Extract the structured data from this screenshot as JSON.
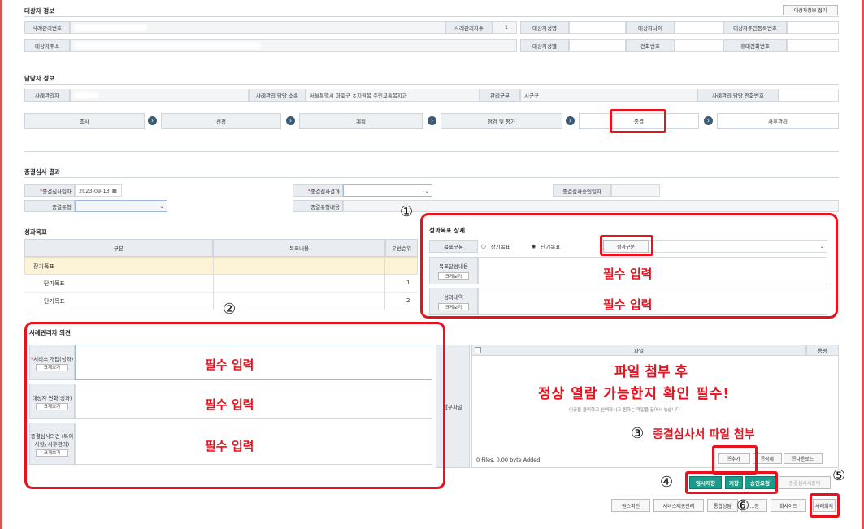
{
  "subject_info": {
    "title": "대상자 정보",
    "collapse_btn": "대상자정보 접기",
    "case_no_label": "사례관리번호",
    "case_count_label": "사례관리차수",
    "case_count_value": "1",
    "name_label": "대상자성명",
    "age_label": "대상자나이",
    "resident_no_label": "대상자주민등록번호",
    "address_label": "대상자주소",
    "gender_label": "대상자성별",
    "phone_label": "전화번호",
    "mobile_label": "휴대전화번호"
  },
  "manager_info": {
    "title": "담당자 정보",
    "manager_label": "사례관리자",
    "dept_label": "사례관리 담당 소속",
    "dept_value": "서울특별시 마포구 ㅎ지원복 주민교통복지과",
    "type_label": "관리구분",
    "type_value": "시군구",
    "phone_label": "사례관리 담당 전화번호"
  },
  "steps": [
    "조사",
    "선정",
    "계획",
    "점검 및 평가",
    "종결",
    "사후관리"
  ],
  "closing_review": {
    "title": "종결심사 결과",
    "date_label": "종결심사일자",
    "date_value": "2023-09-13",
    "result_label": "종결심사결과",
    "approve_date_label": "종결심사승인일자",
    "type_label": "종결유형",
    "type_detail_label": "종결유형내용"
  },
  "goals": {
    "title": "성과목표",
    "col_category": "구분",
    "col_content": "목표내용",
    "col_priority": "우선순위",
    "rows": [
      {
        "label": "장기목표",
        "priority": ""
      },
      {
        "label": "단기목표",
        "priority": "1"
      },
      {
        "label": "단기목표",
        "priority": "2"
      }
    ]
  },
  "goal_detail": {
    "title": "성과목표 상세",
    "goal_type_label": "목표구분",
    "long_term": "장기목표",
    "short_term": "단기목표",
    "result_type_btn": "성과구분",
    "achievement_label": "목표달성내용",
    "result_label": "성과내역",
    "expand_btn": "크게보기"
  },
  "opinion": {
    "title": "사례관리자 의견",
    "service_label": "서비스 개입(성과)",
    "change_label": "대상자 변화(성과)",
    "review_label": "종결심사의견 (특이사항/ 사후관리)",
    "expand_btn": "크게보기"
  },
  "attachment": {
    "label": "첨부파일",
    "col_file": "파일",
    "col_size": "용량",
    "hint": "이곳을 클릭하고 선택하시고 원하는 파일을 끌어서 놓습니다",
    "status": "0 Files, 0.00 byte Added",
    "add_btn": "추가",
    "delete_btn": "삭제",
    "download_btn": "다운로드"
  },
  "actions": {
    "temp_save": "임시저장",
    "save": "저장",
    "approve_req": "승인요청",
    "print_review": "종결심사서출력",
    "row2": [
      "원스피린",
      "서비스제공관리",
      "통합상담",
      "…령",
      "회사이드",
      "사례회의"
    ]
  },
  "annotations": {
    "required": "필수 입력",
    "file_note_1": "파일 첨부 후",
    "file_note_2": "정상 열람 가능한지 확인 필수!",
    "attach_note": "종결심사서 파일 첨부",
    "n1": "①",
    "n2": "②",
    "n3": "③",
    "n4": "④",
    "n5": "⑤",
    "n6": "⑥"
  },
  "colors": {
    "annotation_red": "#e8111d",
    "teal": "#1a9c8c",
    "step_arrow": "#3d5a73"
  }
}
